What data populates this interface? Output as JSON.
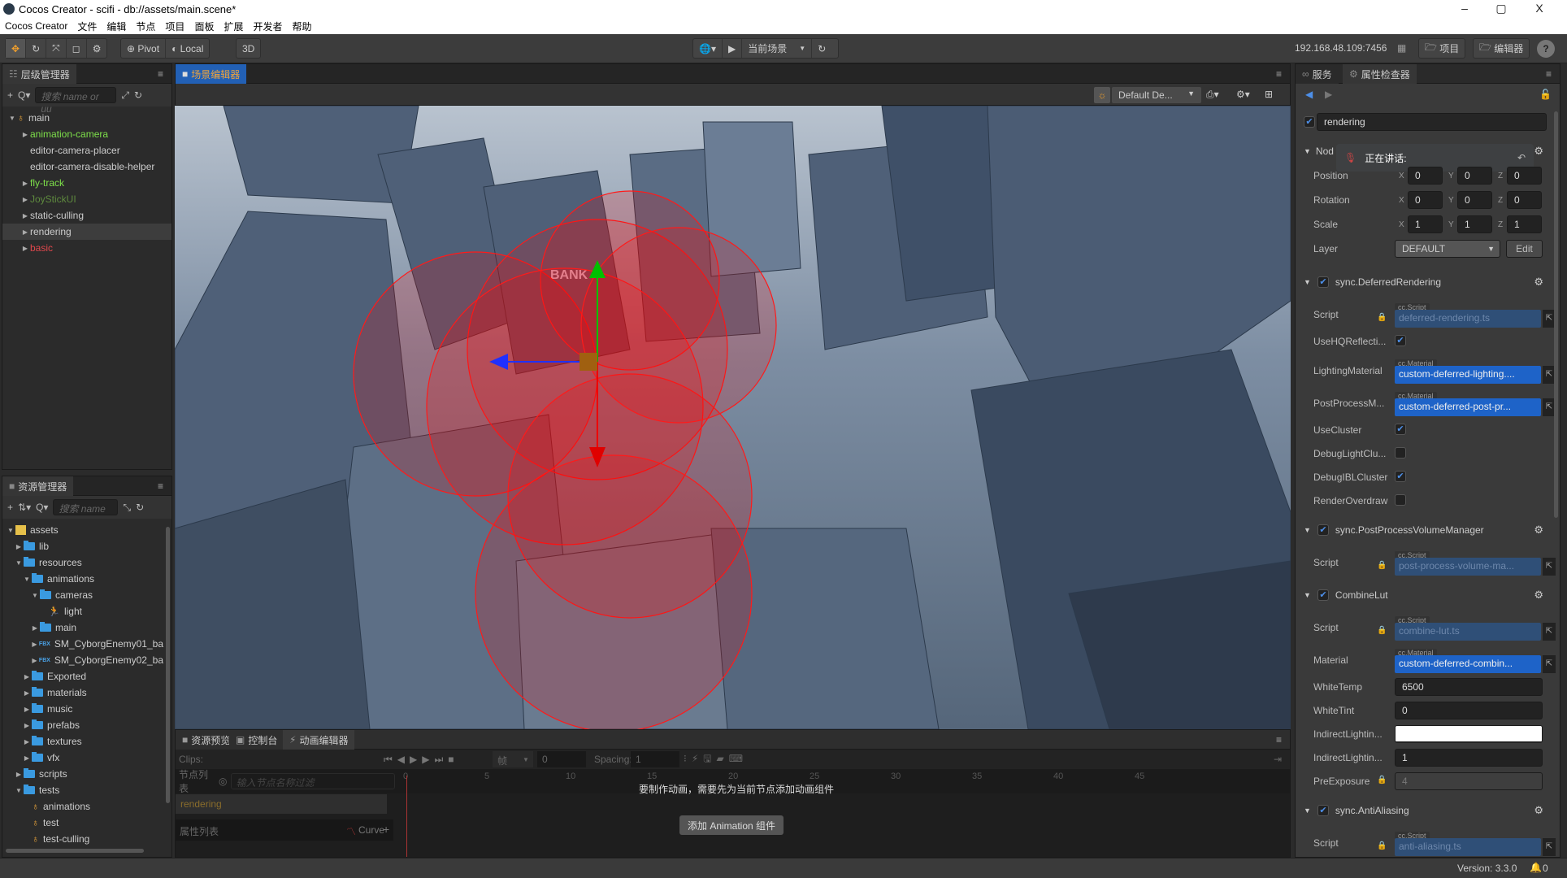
{
  "window": {
    "title": "Cocos Creator - scifi - db://assets/main.scene*",
    "minimize": "–",
    "maximize": "▢",
    "close": "X"
  },
  "menu": [
    "Cocos Creator",
    "文件",
    "编辑",
    "节点",
    "项目",
    "面板",
    "扩展",
    "开发者",
    "帮助"
  ],
  "toolbar": {
    "pivot": "Pivot",
    "local": "Local",
    "mode3d": "3D",
    "scene_select": "当前场景",
    "ip": "192.168.48.109:7456",
    "project_btn": "项目",
    "editor_btn": "编辑器",
    "help": "?"
  },
  "hierarchy": {
    "title": "层级管理器",
    "search_placeholder": "搜索 name or uu",
    "items": [
      {
        "label": "main",
        "depth": 0,
        "arrow": "open",
        "icon": "scene",
        "color": "#cccccc"
      },
      {
        "label": "animation-camera",
        "depth": 1,
        "arrow": "closed",
        "color": "#7ee04a"
      },
      {
        "label": "editor-camera-placer",
        "depth": 1,
        "arrow": "none",
        "color": "#cccccc"
      },
      {
        "label": "editor-camera-disable-helper",
        "depth": 1,
        "arrow": "none",
        "color": "#cccccc"
      },
      {
        "label": "fly-track",
        "depth": 1,
        "arrow": "closed",
        "color": "#7ee04a"
      },
      {
        "label": "JoyStickUI",
        "depth": 1,
        "arrow": "closed",
        "color": "#5e8a3e"
      },
      {
        "label": "static-culling",
        "depth": 1,
        "arrow": "closed",
        "color": "#cccccc"
      },
      {
        "label": "rendering",
        "depth": 1,
        "arrow": "closed",
        "color": "#cccccc",
        "selected": true
      },
      {
        "label": "basic",
        "depth": 1,
        "arrow": "closed",
        "color": "#e0474c"
      }
    ]
  },
  "assets": {
    "title": "资源管理器",
    "search_placeholder": "搜索 name",
    "items": [
      {
        "label": "assets",
        "depth": 0,
        "arrow": "open",
        "icon": "db"
      },
      {
        "label": "lib",
        "depth": 1,
        "arrow": "closed",
        "icon": "folder"
      },
      {
        "label": "resources",
        "depth": 1,
        "arrow": "open",
        "icon": "folder"
      },
      {
        "label": "animations",
        "depth": 2,
        "arrow": "open",
        "icon": "folder"
      },
      {
        "label": "cameras",
        "depth": 3,
        "arrow": "open",
        "icon": "folder"
      },
      {
        "label": "light",
        "depth": 4,
        "arrow": "none",
        "icon": "anim"
      },
      {
        "label": "main",
        "depth": 3,
        "arrow": "closed",
        "icon": "folder"
      },
      {
        "label": "SM_CyborgEnemy01_ba",
        "depth": 3,
        "arrow": "closed",
        "icon": "fbx"
      },
      {
        "label": "SM_CyborgEnemy02_ba",
        "depth": 3,
        "arrow": "closed",
        "icon": "fbx"
      },
      {
        "label": "Exported",
        "depth": 2,
        "arrow": "closed",
        "icon": "folder"
      },
      {
        "label": "materials",
        "depth": 2,
        "arrow": "closed",
        "icon": "folder"
      },
      {
        "label": "music",
        "depth": 2,
        "arrow": "closed",
        "icon": "folder"
      },
      {
        "label": "prefabs",
        "depth": 2,
        "arrow": "closed",
        "icon": "folder"
      },
      {
        "label": "textures",
        "depth": 2,
        "arrow": "closed",
        "icon": "folder"
      },
      {
        "label": "vfx",
        "depth": 2,
        "arrow": "closed",
        "icon": "folder"
      },
      {
        "label": "scripts",
        "depth": 1,
        "arrow": "closed",
        "icon": "folder"
      },
      {
        "label": "tests",
        "depth": 1,
        "arrow": "open",
        "icon": "folder"
      },
      {
        "label": "animations",
        "depth": 2,
        "arrow": "none",
        "icon": "scene"
      },
      {
        "label": "test",
        "depth": 2,
        "arrow": "none",
        "icon": "scene"
      },
      {
        "label": "test-culling",
        "depth": 2,
        "arrow": "none",
        "icon": "scene"
      }
    ]
  },
  "scene": {
    "tab": "场景编辑器",
    "camera_select": "Default De...",
    "gizmo_label": "BANK"
  },
  "bottom": {
    "tabs": [
      "资源预览",
      "控制台",
      "动画编辑器"
    ],
    "clips_label": "Clips:",
    "frame_unit": "帧",
    "frame_value": "0",
    "spacing_label": "Spacing:",
    "spacing_value": "1",
    "node_list_label": "节点列表",
    "node_filter_placeholder": "输入节点名称过滤",
    "node_name": "rendering",
    "prop_list_label": "属性列表",
    "curve_label": "Curve",
    "ruler": [
      "0",
      "5",
      "10",
      "15",
      "20",
      "25",
      "30",
      "35",
      "40",
      "45"
    ],
    "hint": "要制作动画，需要先为当前节点添加动画组件",
    "add_button": "添加 Animation 组件"
  },
  "inspector": {
    "tabs": [
      "服务",
      "属性检查器"
    ],
    "node_name": "rendering",
    "node_section": "Nod",
    "speaking": "正在讲话:",
    "transform": [
      {
        "label": "Position",
        "x": "0",
        "y": "0",
        "z": "0"
      },
      {
        "label": "Rotation",
        "x": "0",
        "y": "0",
        "z": "0"
      },
      {
        "label": "Scale",
        "x": "1",
        "y": "1",
        "z": "1"
      }
    ],
    "layer": {
      "label": "Layer",
      "value": "DEFAULT",
      "edit": "Edit"
    },
    "components": [
      {
        "name": "sync.DeferredRendering",
        "rows": [
          {
            "label": "Script",
            "type": "script",
            "tag": "cc.Script",
            "value": "deferred-rendering.ts"
          },
          {
            "label": "UseHQReflecti...",
            "type": "check",
            "checked": true
          },
          {
            "label": "LightingMaterial",
            "type": "material",
            "tag": "cc.Material",
            "value": "custom-deferred-lighting...."
          },
          {
            "label": "PostProcessM...",
            "type": "material",
            "tag": "cc.Material",
            "value": "custom-deferred-post-pr..."
          },
          {
            "label": "UseCluster",
            "type": "check",
            "checked": true
          },
          {
            "label": "DebugLightClu...",
            "type": "check",
            "checked": false
          },
          {
            "label": "DebugIBLCluster",
            "type": "check",
            "checked": true
          },
          {
            "label": "RenderOverdraw",
            "type": "check",
            "checked": false
          }
        ]
      },
      {
        "name": "sync.PostProcessVolumeManager",
        "rows": [
          {
            "label": "Script",
            "type": "script",
            "tag": "cc.Script",
            "value": "post-process-volume-ma..."
          }
        ]
      },
      {
        "name": "CombineLut",
        "rows": [
          {
            "label": "Script",
            "type": "script",
            "tag": "cc.Script",
            "value": "combine-lut.ts"
          },
          {
            "label": "Material",
            "type": "material",
            "tag": "cc.Material",
            "value": "custom-deferred-combin..."
          },
          {
            "label": "WhiteTemp",
            "type": "number",
            "value": "6500"
          },
          {
            "label": "WhiteTint",
            "type": "number",
            "value": "0"
          },
          {
            "label": "IndirectLightin...",
            "type": "color",
            "value": "#ffffff"
          },
          {
            "label": "IndirectLightin...",
            "type": "number",
            "value": "1"
          },
          {
            "label": "PreExposure",
            "type": "locked",
            "value": "4"
          }
        ]
      },
      {
        "name": "sync.AntiAliasing",
        "rows": [
          {
            "label": "Script",
            "type": "script",
            "tag": "cc.Script",
            "value": "anti-aliasing.ts"
          }
        ]
      }
    ]
  },
  "status": {
    "version": "Version: 3.3.0",
    "notifications": "0"
  }
}
